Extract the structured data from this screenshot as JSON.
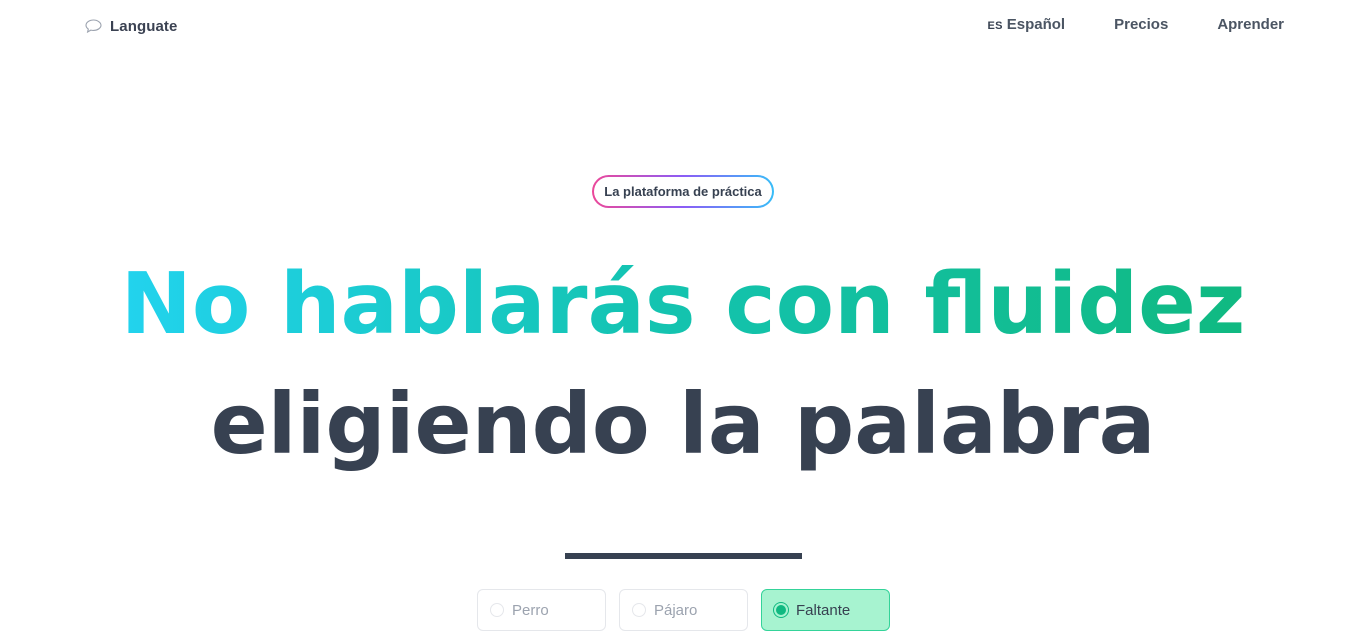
{
  "header": {
    "logo_text": "Languate",
    "nav": {
      "language_code": "ES",
      "language_label": "Español",
      "pricing": "Precios",
      "learn": "Aprender"
    }
  },
  "hero": {
    "badge": "La plataforma de práctica",
    "line1": "No hablarás con fluidez",
    "line2": "eligiendo la palabra"
  },
  "options": [
    {
      "label": "Perro",
      "selected": false
    },
    {
      "label": "Pájaro",
      "selected": false
    },
    {
      "label": "Faltante",
      "selected": true
    }
  ],
  "colors": {
    "gradient_start": "#22d3ee",
    "gradient_end": "#10b981",
    "text_dark": "#374151",
    "selected_bg": "#a7f3d0",
    "selected_accent": "#10b981"
  },
  "icons": {
    "logo": "speech-bubble-icon"
  }
}
